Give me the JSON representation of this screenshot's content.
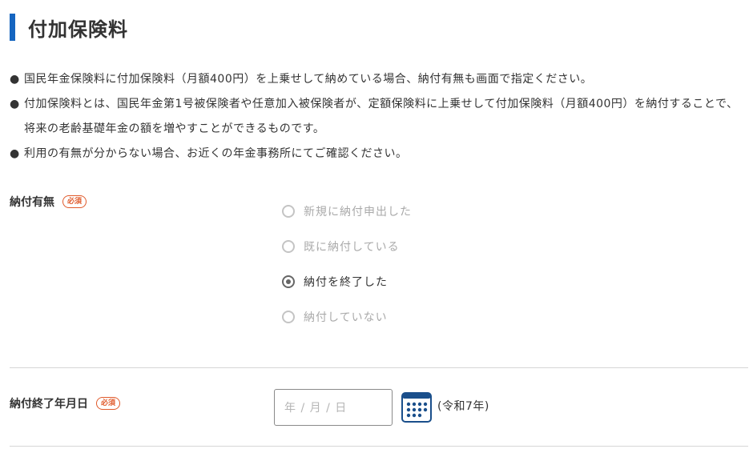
{
  "section": {
    "title": "付加保険料"
  },
  "notes": [
    {
      "bullet": "●",
      "text": "国民年金保険料に付加保険料（月額400円）を上乗せして納めている場合、納付有無も画面で指定ください。"
    },
    {
      "bullet": "●",
      "text": "付加保険料とは、国民年金第1号被保険者や任意加入被保険者が、定額保険料に上乗せして付加保険料（月額400円）を納付することで、将来の老齢基礎年金の額を増やすことができるものです。"
    },
    {
      "bullet": "●",
      "text": "利用の有無が分からない場合、お近くの年金事務所にてご確認ください。"
    }
  ],
  "payment_status": {
    "label": "納付有無",
    "required_badge": "必須",
    "options": [
      {
        "label": "新規に納付申出した",
        "checked": false
      },
      {
        "label": "既に納付している",
        "checked": false
      },
      {
        "label": "納付を終了した",
        "checked": true
      },
      {
        "label": "納付していない",
        "checked": false
      }
    ]
  },
  "end_date": {
    "label": "納付終了年月日",
    "required_badge": "必須",
    "placeholder": "年 / 月 / 日",
    "era_note": "(令和7年)"
  },
  "colors": {
    "accent": "#1565c0",
    "required": "#e05a2b",
    "calendar": "#1a4f8b"
  },
  "icons": {
    "calendar": "calendar-icon",
    "radio_checked": "radio-checked-icon",
    "radio_unchecked": "radio-unchecked-icon"
  }
}
